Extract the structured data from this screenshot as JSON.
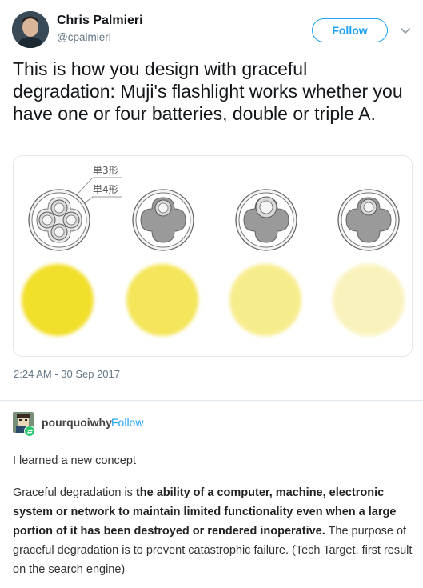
{
  "tweet": {
    "author_name": "Chris Palmieri",
    "author_handle": "@cpalmieri",
    "follow_label": "Follow",
    "text": "This is how you design with graceful degradation: Muji's flashlight works whether you have one or four batteries, double or triple A.",
    "image": {
      "label_aa": "単3形",
      "label_aaa": "単4形",
      "light_colors": [
        "#f2df2c",
        "#f4e55a",
        "#f7ec8c",
        "#faf2bd"
      ],
      "icons": [
        "four-aaa-battery-diagram-icon",
        "one-aaa-battery-diagram-icon",
        "one-aa-battery-diagram-icon",
        "single-battery-diagram-icon"
      ]
    },
    "timestamp": "2:24 AM - 30 Sep 2017"
  },
  "post": {
    "username": "pourquoiwhy",
    "follow_label": "Follow",
    "line1": "I learned a new concept",
    "para_intro": "Graceful degradation is ",
    "para_bold": "the ability of a computer, machine, electronic system or network to maintain limited functionality even when a large portion of it has been destroyed or rendered inoperative.",
    "para_rest": " The purpose of graceful degradation is to prevent catastrophic failure. (Tech Target, first result on the search engine)"
  }
}
